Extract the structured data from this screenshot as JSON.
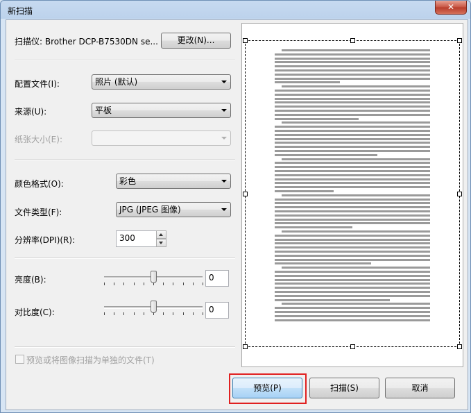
{
  "window": {
    "title": "新扫描",
    "close_glyph": "✕"
  },
  "scanner": {
    "label": "扫描仪: Brother DCP-B7530DN se...",
    "change_button": "更改(N)..."
  },
  "profile": {
    "label": "配置文件(I):",
    "value": "照片 (默认)"
  },
  "source": {
    "label": "来源(U):",
    "value": "平板"
  },
  "paper_size": {
    "label": "纸张大小(E):",
    "value": ""
  },
  "color_format": {
    "label": "颜色格式(O):",
    "value": "彩色"
  },
  "file_type": {
    "label": "文件类型(F):",
    "value": "JPG (JPEG 图像)"
  },
  "resolution": {
    "label": "分辨率(DPI)(R):",
    "value": "300"
  },
  "brightness": {
    "label": "亮度(B):",
    "value": "0",
    "slider_fraction": 0.5
  },
  "contrast": {
    "label": "对比度(C):",
    "value": "0",
    "slider_fraction": 0.5
  },
  "separate_files": {
    "label": "预览或将图像扫描为单独的文件(T)",
    "checked": false
  },
  "buttons": {
    "preview": "预览(P)",
    "scan": "扫描(S)",
    "cancel": "取消"
  },
  "colors": {
    "highlight": "#e02020"
  },
  "preview_document": {
    "paragraphs": [
      "本次支部大会的主要内容为学习研讨文章《学思践悟中国梦实践篇》。",
      "会议开始，支部书记首先阐明会议议程，今天我们集中起来共同学习研讨",
      "文章《学思践悟中国梦实践篇》，下面为大家分享一下文章内容。",
      "中国共产党人的理想信念，是马克思主义真理信仰，共产主义远大理想和中国特色社会主义共同理想。这是共产党人的精神支柱和政治灵魂。",
      "学思践悟，知行合一。学习是前提，思考是关键，实践是根本。",
      "学习，要坚持理论联系实际，做到学以致用，用以促学。",
      "在新时代的征程上，我们要不忘初心、牢记使命，为实现中国梦而不懈奋斗。"
    ]
  }
}
